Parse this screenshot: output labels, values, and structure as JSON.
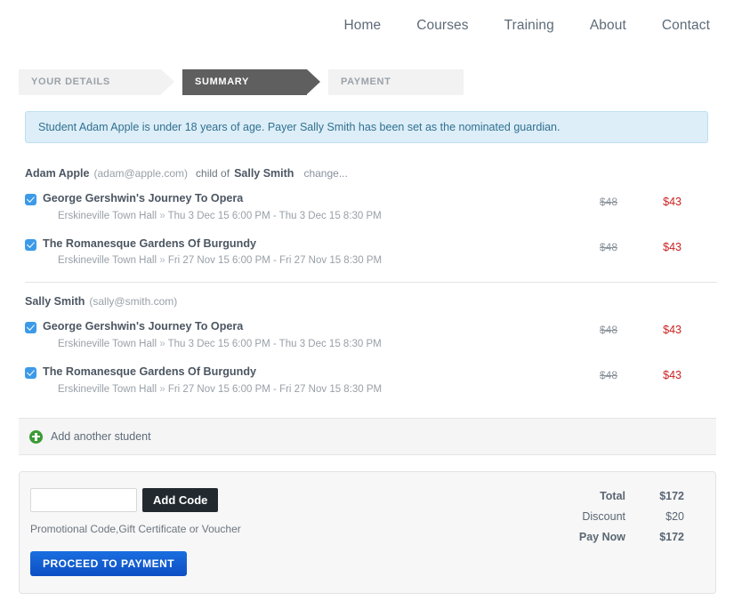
{
  "nav": {
    "items": [
      {
        "label": "Home"
      },
      {
        "label": "Courses"
      },
      {
        "label": "Training"
      },
      {
        "label": "About"
      },
      {
        "label": "Contact"
      }
    ]
  },
  "steps": [
    {
      "label": "YOUR DETAILS",
      "state": "inactive"
    },
    {
      "label": "SUMMARY",
      "state": "active"
    },
    {
      "label": "PAYMENT",
      "state": "inactive"
    }
  ],
  "banner": {
    "text": "Student Adam Apple is under 18 years of age. Payer Sally Smith has been set as the nominated guardian."
  },
  "students": [
    {
      "name": "Adam Apple",
      "email": "(adam@apple.com)",
      "relation_prefix": "child of",
      "relation_name": "Sally Smith",
      "change_label": "change...",
      "items": [
        {
          "checked": true,
          "title": "George Gershwin's Journey To Opera",
          "venue": "Erskineville Town Hall",
          "separator": "»",
          "schedule": "Thu 3 Dec 15 6:00 PM - Thu 3 Dec 15 8:30 PM",
          "price_original": "$48",
          "price_current": "$43"
        },
        {
          "checked": true,
          "title": "The Romanesque Gardens Of Burgundy",
          "venue": "Erskineville Town Hall",
          "separator": "»",
          "schedule": "Fri 27 Nov 15 6:00 PM - Fri 27 Nov 15 8:30 PM",
          "price_original": "$48",
          "price_current": "$43"
        }
      ]
    },
    {
      "name": "Sally Smith",
      "email": "(sally@smith.com)",
      "relation_prefix": "",
      "relation_name": "",
      "change_label": "",
      "items": [
        {
          "checked": true,
          "title": "George Gershwin's Journey To Opera",
          "venue": "Erskineville Town Hall",
          "separator": "»",
          "schedule": "Thu 3 Dec 15 6:00 PM - Thu 3 Dec 15 8:30 PM",
          "price_original": "$48",
          "price_current": "$43"
        },
        {
          "checked": true,
          "title": "The Romanesque Gardens Of Burgundy",
          "venue": "Erskineville Town Hall",
          "separator": "»",
          "schedule": "Fri 27 Nov 15 6:00 PM - Fri 27 Nov 15 8:30 PM",
          "price_original": "$48",
          "price_current": "$43"
        }
      ]
    }
  ],
  "add_student": {
    "label": "Add another student",
    "icon": "plus-circle-icon"
  },
  "promo": {
    "input_value": "",
    "placeholder": "",
    "button_label": "Add Code",
    "hint": "Promotional Code,Gift Certificate or Voucher"
  },
  "totals": [
    {
      "label": "Total",
      "value": "$172",
      "bold": true
    },
    {
      "label": "Discount",
      "value": "$20",
      "bold": false
    },
    {
      "label": "Pay Now",
      "value": "$172",
      "bold": true
    }
  ],
  "proceed": {
    "label": "PROCEED TO PAYMENT"
  },
  "colors": {
    "accent_blue": "#3c9ae8",
    "price_red": "#cc1f1f",
    "banner_bg": "#ddeef8",
    "banner_border": "#bcdff1",
    "banner_text": "#31708f",
    "step_active_bg": "#5f5f5f",
    "step_inactive_bg": "#f2f2f2",
    "add_code_bg": "#222a30",
    "proceed_bg": "#0c4fc4",
    "plus_green": "#3a9b35"
  }
}
